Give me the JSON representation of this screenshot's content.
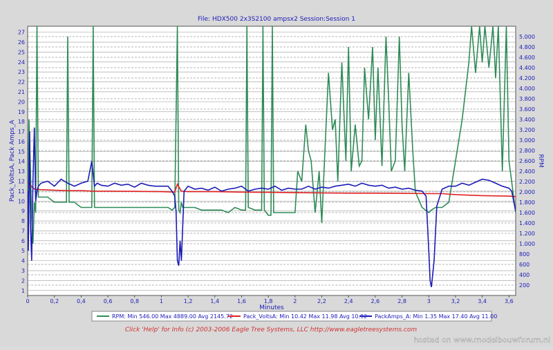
{
  "chart_data": {
    "type": "line",
    "title": "File: HDX500 2x3S2100 ampsx2   Session:Session 1",
    "xlabel": "Minutes",
    "ylabel_left": "Pack_VoltsA, Pack Amps_A",
    "ylabel_right": "RPM",
    "xlim": [
      0,
      3.65
    ],
    "ylim_left": [
      0.5,
      27.6
    ],
    "ylim_right": [
      0,
      5200
    ],
    "x_ticks": [
      "0",
      "0,2",
      "0,4",
      "0,6",
      "0,8",
      "1",
      "1,2",
      "1,4",
      "1,6",
      "1,8",
      "2",
      "2,2",
      "2,4",
      "2,6",
      "2,8",
      "3",
      "3,2",
      "3,4",
      "3,6"
    ],
    "y_left_ticks": [
      "1",
      "2",
      "3",
      "4",
      "5",
      "6",
      "7",
      "8",
      "9",
      "10",
      "11",
      "12",
      "13",
      "14",
      "15",
      "16",
      "17",
      "18",
      "19",
      "20",
      "21",
      "22",
      "23",
      "24",
      "25",
      "26",
      "27"
    ],
    "y_right_ticks": [
      "200",
      "400",
      "600",
      "800",
      "1.000",
      "1.200",
      "1.400",
      "1.600",
      "1.800",
      "2.000",
      "2.200",
      "2.400",
      "2.600",
      "2.800",
      "3.000",
      "3.200",
      "3.400",
      "3.600",
      "3.800",
      "4.000",
      "4.200",
      "4.400",
      "4.600",
      "4.800",
      "5.000"
    ],
    "grid": true,
    "series": [
      {
        "name": "RPM:",
        "legend_text": "RPM:  Min 546.00 Max 4889.00 Avg 2145.72",
        "axis": "right",
        "color": "#2e8b57",
        "x": [
          0,
          0.01,
          0.02,
          0.03,
          0.04,
          0.05,
          0.06,
          0.07,
          0.08,
          0.1,
          0.15,
          0.2,
          0.25,
          0.29,
          0.3,
          0.31,
          0.35,
          0.4,
          0.45,
          0.48,
          0.49,
          0.5,
          0.51,
          0.55,
          0.6,
          0.7,
          0.8,
          0.9,
          1.0,
          1.05,
          1.08,
          1.1,
          1.12,
          1.13,
          1.14,
          1.15,
          1.16,
          1.18,
          1.2,
          1.25,
          1.3,
          1.35,
          1.4,
          1.45,
          1.5,
          1.55,
          1.6,
          1.63,
          1.64,
          1.65,
          1.7,
          1.75,
          1.76,
          1.77,
          1.8,
          1.82,
          1.83,
          1.84,
          1.9,
          1.95,
          2.0,
          2.02,
          2.05,
          2.08,
          2.1,
          2.12,
          2.15,
          2.18,
          2.2,
          2.22,
          2.25,
          2.28,
          2.3,
          2.32,
          2.35,
          2.38,
          2.4,
          2.42,
          2.45,
          2.48,
          2.5,
          2.52,
          2.55,
          2.58,
          2.6,
          2.62,
          2.65,
          2.68,
          2.7,
          2.72,
          2.75,
          2.78,
          2.8,
          2.82,
          2.85,
          2.88,
          2.9,
          2.95,
          3.0,
          3.02,
          3.05,
          3.1,
          3.15,
          3.2,
          3.25,
          3.3,
          3.32,
          3.35,
          3.38,
          3.4,
          3.42,
          3.45,
          3.48,
          3.5,
          3.52,
          3.55,
          3.58,
          3.6,
          3.62,
          3.65
        ],
        "y": [
          1700,
          3400,
          2500,
          1500,
          1000,
          1800,
          1600,
          5200,
          1900,
          1900,
          1900,
          1800,
          1800,
          1800,
          5000,
          1800,
          1800,
          1700,
          1700,
          1700,
          5200,
          1700,
          1700,
          1700,
          1700,
          1700,
          1700,
          1700,
          1700,
          1700,
          1650,
          1700,
          5200,
          1650,
          1600,
          1800,
          1700,
          1700,
          1700,
          1700,
          1650,
          1650,
          1650,
          1650,
          1600,
          1700,
          1650,
          1650,
          5200,
          1700,
          1650,
          1650,
          5200,
          1650,
          1550,
          1550,
          5200,
          1600,
          1600,
          1600,
          1600,
          2400,
          2200,
          3300,
          2800,
          2600,
          1600,
          2400,
          1400,
          2600,
          4300,
          3200,
          3400,
          2200,
          4500,
          2600,
          4800,
          2400,
          3300,
          2500,
          2600,
          4400,
          3400,
          4800,
          3000,
          4400,
          2500,
          5000,
          3800,
          2400,
          2600,
          5000,
          3300,
          2400,
          4300,
          2800,
          2000,
          1700,
          1600,
          1650,
          1700,
          1700,
          1800,
          2600,
          3400,
          4500,
          5200,
          4300,
          5200,
          4500,
          5200,
          4400,
          5200,
          4200,
          5200,
          2400,
          5200,
          2600,
          2200,
          1600
        ]
      },
      {
        "name": "Pack_VoltsA:",
        "legend_text": "Pack_VoltsA:  Min 10.42 Max 11.98 Avg 10.92",
        "axis": "left",
        "color": "#e02020",
        "x": [
          0,
          0.02,
          0.05,
          0.1,
          0.2,
          0.3,
          0.4,
          0.5,
          0.6,
          0.8,
          1.0,
          1.1,
          1.12,
          1.15,
          1.2,
          1.4,
          1.6,
          1.8,
          2.0,
          2.2,
          2.4,
          2.6,
          2.8,
          3.0,
          3.1,
          3.2,
          3.4,
          3.6,
          3.65
        ],
        "y": [
          11.9,
          11.6,
          11.2,
          11.15,
          11.1,
          11.05,
          11.05,
          11.0,
          11.0,
          10.98,
          10.95,
          10.9,
          11.7,
          11.0,
          10.95,
          10.95,
          10.9,
          10.88,
          10.85,
          10.82,
          10.8,
          10.8,
          10.78,
          10.75,
          10.75,
          10.65,
          10.55,
          10.5,
          10.45
        ]
      },
      {
        "name": "PackAmps_A:",
        "legend_text": "PackAmps_A:  Min 1.35 Max 17.40 Avg 11.00",
        "axis": "left",
        "color": "#1a1ab8",
        "x": [
          0,
          0.005,
          0.01,
          0.015,
          0.02,
          0.03,
          0.04,
          0.05,
          0.06,
          0.07,
          0.08,
          0.1,
          0.15,
          0.2,
          0.25,
          0.3,
          0.35,
          0.4,
          0.45,
          0.48,
          0.5,
          0.52,
          0.55,
          0.6,
          0.65,
          0.7,
          0.75,
          0.8,
          0.85,
          0.9,
          0.95,
          1.0,
          1.05,
          1.08,
          1.1,
          1.11,
          1.12,
          1.13,
          1.14,
          1.15,
          1.17,
          1.2,
          1.25,
          1.3,
          1.35,
          1.4,
          1.45,
          1.5,
          1.55,
          1.6,
          1.65,
          1.7,
          1.75,
          1.8,
          1.85,
          1.9,
          1.95,
          2.0,
          2.05,
          2.1,
          2.15,
          2.2,
          2.25,
          2.3,
          2.35,
          2.4,
          2.45,
          2.5,
          2.55,
          2.6,
          2.65,
          2.7,
          2.75,
          2.8,
          2.85,
          2.9,
          2.95,
          2.98,
          3.0,
          3.01,
          3.02,
          3.04,
          3.06,
          3.1,
          3.15,
          3.2,
          3.25,
          3.3,
          3.35,
          3.4,
          3.45,
          3.5,
          3.55,
          3.6,
          3.62,
          3.65
        ],
        "y": [
          11,
          5,
          12,
          17,
          8,
          4,
          12,
          17.4,
          10,
          11,
          11.5,
          11.8,
          12,
          11.5,
          12.2,
          11.8,
          11.5,
          11.8,
          12,
          14,
          11.5,
          11.8,
          11.6,
          11.5,
          11.8,
          11.6,
          11.7,
          11.4,
          11.8,
          11.6,
          11.5,
          11.5,
          11.5,
          11,
          10.5,
          9,
          4,
          3.5,
          6,
          4,
          11,
          11.5,
          11.2,
          11.3,
          11.1,
          11.4,
          11,
          11.2,
          11.3,
          11.5,
          11,
          11.2,
          11.3,
          11.2,
          11.5,
          11.1,
          11.3,
          11.2,
          11.2,
          11.5,
          11.2,
          11.4,
          11.3,
          11.5,
          11.6,
          11.7,
          11.5,
          11.8,
          11.6,
          11.5,
          11.6,
          11.3,
          11.4,
          11.2,
          11.3,
          11.1,
          11.0,
          10.5,
          5,
          2,
          1.35,
          4,
          9.5,
          11.2,
          11.5,
          11.5,
          11.8,
          11.6,
          11.9,
          12.2,
          12.1,
          11.8,
          11.5,
          11.3,
          11,
          9
        ]
      }
    ],
    "footer": "Click 'Help' for Info  (c) 2003-2006 Eagle Tree Systems, LLC     http://www.eagletreesystems.com"
  },
  "watermark": "hosted on www.modelbouwforum.nl"
}
